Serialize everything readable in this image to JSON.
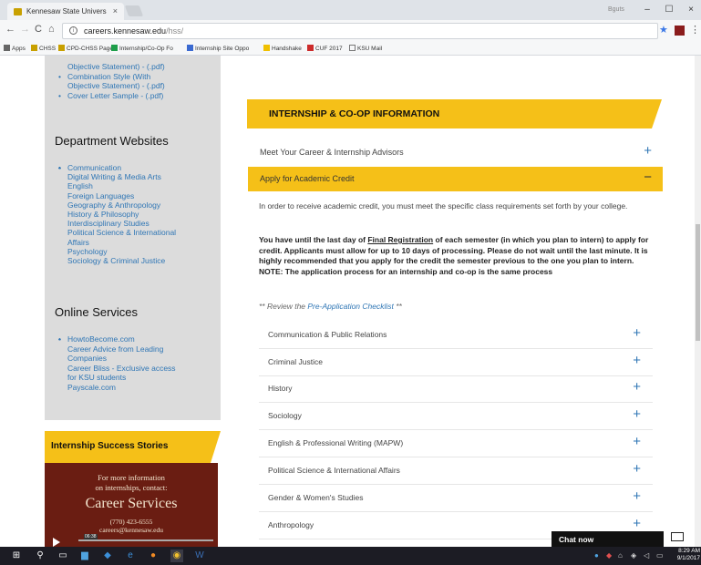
{
  "browser": {
    "tab_title": "Kennesaw State Univers",
    "tab_close": "×",
    "user": "Bguts",
    "window_min": "–",
    "window_max": "☐",
    "window_close": "×",
    "nav_back": "←",
    "nav_forward": "→",
    "nav_reload": "C",
    "nav_home": "⌂",
    "url_host": "careers.kennesaw.edu",
    "url_path": "/hss/",
    "star": "★",
    "menu": "⋮",
    "bookmarks": [
      "Apps",
      "CHSS",
      "CPD-CHSS Page",
      "Internship/Co-Op Fo",
      "Internship Site Oppo",
      "Handshake",
      "CUF 2017",
      "KSU Mail"
    ]
  },
  "sidebar": {
    "resource_links": [
      "Objective Statement) - (.pdf)",
      "Combination Style (With",
      "Objective Statement) - (.pdf)",
      "Cover Letter Sample - (.pdf)"
    ],
    "dept_heading": "Department Websites",
    "dept_links": [
      "Communication",
      "Digital Writing & Media Arts",
      "English",
      "Foreign Languages",
      "Geography & Anthropology",
      "History & Philosophy",
      "Interdisciplinary Studies",
      "Political Science & International",
      "Affairs",
      "Psychology",
      "Sociology & Criminal Justice"
    ],
    "online_heading": "Online Services",
    "online_links": [
      "HowtoBecome.com",
      "Career Advice from Leading",
      "Companies",
      "Career Bliss - Exclusive access",
      "for KSU students",
      "Payscale.com"
    ],
    "stories_heading": "Internship Success Stories",
    "video": {
      "line1": "For more information",
      "line2": "on internships, contact:",
      "line3": "Career Services",
      "line4": "(770) 423-6555",
      "line5": "careers@kennesaw.edu",
      "time": "06:38"
    }
  },
  "main": {
    "section_heading": "INTERNSHIP & CO-OP INFORMATION",
    "accordion_advisors": "Meet Your Career & Internship Advisors",
    "accordion_credit": "Apply for Academic Credit",
    "plus": "+",
    "minus": "−",
    "intro_text": "In order to receive academic credit, you must meet the specific class requirements set forth by your college.",
    "deadline_prefix": "You have until the last day of ",
    "deadline_link": "Final Registration",
    "deadline_text": " of each semester (in which you plan to intern) to apply for credit. Applicants must allow for up to 10 days of processing. Please do not wait until the last minute. It is highly recommended that you apply for the credit the semester previous to the one you plan to intern. NOTE: The application process for an internship and co-op is the same process",
    "review_prefix": "** Review the ",
    "review_link": "Pre-Application Checklist",
    "review_suffix": " **",
    "departments": [
      "Communication & Public Relations",
      "Criminal Justice",
      "History",
      "Sociology",
      "English & Professional Writing (MAPW)",
      "Political Science & International Affairs",
      "Gender & Women's Studies",
      "Anthropology"
    ]
  },
  "chat": {
    "label": "Chat now"
  },
  "taskbar": {
    "time": "8:29 AM",
    "date": "9/1/2017"
  },
  "colors": {
    "ksu_gold": "#f5c018",
    "link_blue": "#2f76b5",
    "sidebar_gray": "#dcdcdc"
  }
}
